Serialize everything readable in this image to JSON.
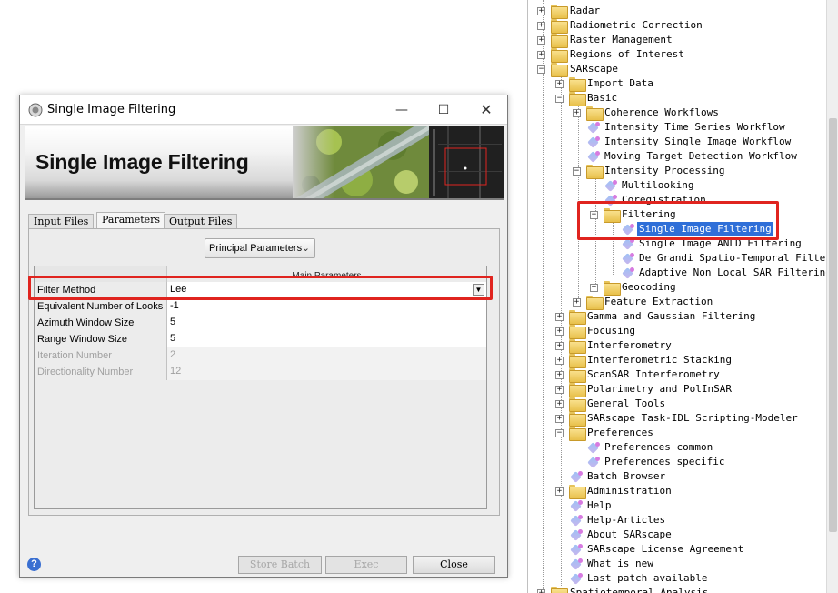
{
  "dialog": {
    "title": "Single Image Filtering",
    "banner_title": "Single Image Filtering",
    "tabs": [
      {
        "label": "Input Files"
      },
      {
        "label": "Parameters"
      },
      {
        "label": "Output Files"
      }
    ],
    "active_tab": "Parameters",
    "principal_dropdown": "Principal Parameters",
    "grid_header": "Main Parameters",
    "params": [
      {
        "label": "Filter Method",
        "value": "Lee",
        "enabled": true
      },
      {
        "label": "Equivalent Number of Looks",
        "value": "-1",
        "enabled": true
      },
      {
        "label": "Azimuth Window Size",
        "value": "5",
        "enabled": true
      },
      {
        "label": "Range Window Size",
        "value": "5",
        "enabled": true
      },
      {
        "label": "Iteration Number",
        "value": "2",
        "enabled": false
      },
      {
        "label": "Directionality Number",
        "value": "12",
        "enabled": false
      }
    ],
    "buttons": {
      "store_batch": "Store Batch",
      "exec": "Exec",
      "close": "Close"
    },
    "help_icon": "?"
  },
  "tree": {
    "nodes": [
      {
        "label": "Radar"
      },
      {
        "label": "Radiometric Correction"
      },
      {
        "label": "Raster Management"
      },
      {
        "label": "Regions of Interest"
      },
      {
        "label": "SARscape"
      },
      {
        "label": "Import Data"
      },
      {
        "label": "Basic"
      },
      {
        "label": "Coherence Workflows"
      },
      {
        "label": "Intensity Time Series Workflow"
      },
      {
        "label": "Intensity Single Image Workflow"
      },
      {
        "label": "Moving Target Detection Workflow"
      },
      {
        "label": "Intensity Processing"
      },
      {
        "label": "Multilooking"
      },
      {
        "label": "Coregistration"
      },
      {
        "label": "Filtering"
      },
      {
        "label": "Single Image Filtering"
      },
      {
        "label": "Single Image ANLD Filtering"
      },
      {
        "label": "De Grandi Spatio-Temporal Filtering"
      },
      {
        "label": "Adaptive Non Local SAR Filtering"
      },
      {
        "label": "Geocoding"
      },
      {
        "label": "Feature Extraction"
      },
      {
        "label": "Gamma and Gaussian Filtering"
      },
      {
        "label": "Focusing"
      },
      {
        "label": "Interferometry"
      },
      {
        "label": "Interferometric Stacking"
      },
      {
        "label": "ScanSAR Interferometry"
      },
      {
        "label": "Polarimetry and PolInSAR"
      },
      {
        "label": "General Tools"
      },
      {
        "label": "SARscape Task-IDL Scripting-Modeler"
      },
      {
        "label": "Preferences"
      },
      {
        "label": "Preferences common"
      },
      {
        "label": "Preferences specific"
      },
      {
        "label": "Batch Browser"
      },
      {
        "label": "Administration"
      },
      {
        "label": "Help"
      },
      {
        "label": "Help-Articles"
      },
      {
        "label": "About SARscape"
      },
      {
        "label": "SARscape License Agreement"
      },
      {
        "label": "What is new"
      },
      {
        "label": "Last patch available"
      },
      {
        "label": "Spatiotemporal Analysis"
      }
    ]
  },
  "colors": {
    "highlight": "#e0241f",
    "selection": "#2f6fd8"
  }
}
